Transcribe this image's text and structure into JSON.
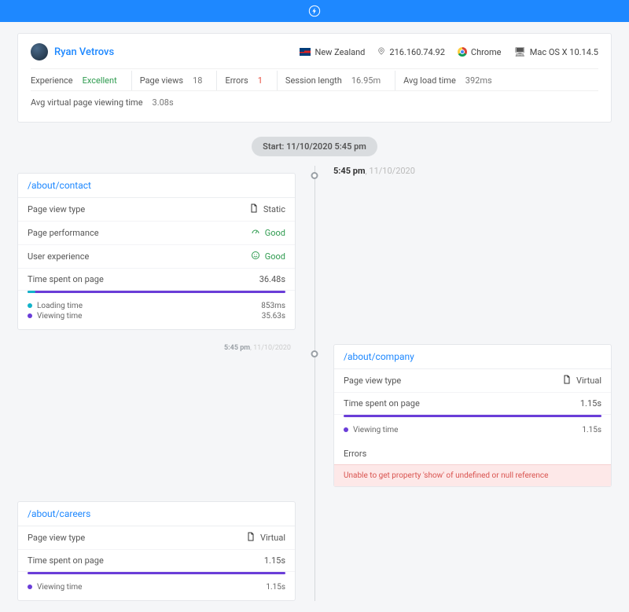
{
  "user": {
    "name": "Ryan Vetrovs"
  },
  "meta": {
    "country": "New Zealand",
    "ip": "216.160.74.92",
    "browser": "Chrome",
    "os": "Mac OS X 10.14.5"
  },
  "stats": {
    "experience": {
      "label": "Experience",
      "value": "Excellent"
    },
    "pageviews": {
      "label": "Page views",
      "value": "18"
    },
    "errors": {
      "label": "Errors",
      "value": "1"
    },
    "session": {
      "label": "Session length",
      "value": "16.95m"
    },
    "avgload": {
      "label": "Avg load time",
      "value": "392ms"
    },
    "avgvirtual": {
      "label": "Avg virtual page viewing time",
      "value": "3.08s"
    }
  },
  "start": "Start: 11/10/2020 5:45 pm",
  "ts1": {
    "time": "5:45 pm",
    "date": "11/10/2020"
  },
  "ts2": {
    "time": "5:45 pm",
    "date": "11/10/2020"
  },
  "labels": {
    "pvtype": "Page view type",
    "pperf": "Page performance",
    "uexp": "User experience",
    "tspent": "Time spent on page",
    "loading": "Loading time",
    "viewing": "Viewing time",
    "errors": "Errors",
    "static": "Static",
    "virtual": "Virtual",
    "good": "Good"
  },
  "pages": {
    "contact": {
      "path": "/about/contact",
      "type": "Static",
      "perf": "Good",
      "ux": "Good",
      "time": "36.48s",
      "loading": "853ms",
      "viewing": "35.63s"
    },
    "careers": {
      "path": "/about/careers",
      "type": "Virtual",
      "time": "1.15s",
      "viewing": "1.15s"
    },
    "company": {
      "path": "/about/company",
      "type": "Virtual",
      "time": "1.15s",
      "viewing": "1.15s",
      "error": "Unable to get property 'show' of undefined or null reference"
    }
  }
}
